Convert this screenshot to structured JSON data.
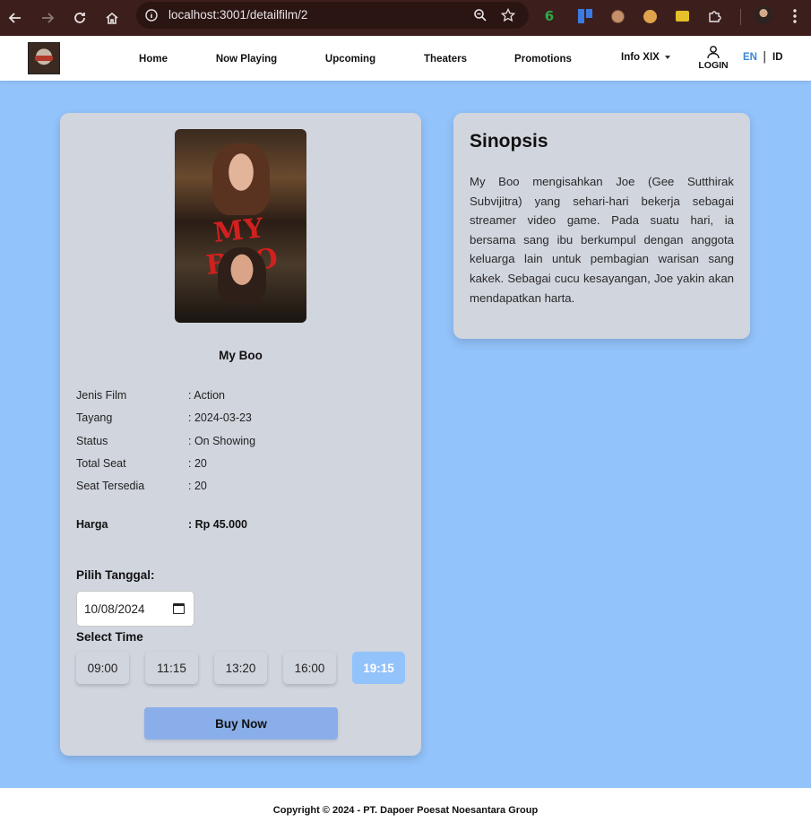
{
  "browser": {
    "url": "localhost:3001/detailfilm/2",
    "extensions": [
      "green-six-icon",
      "blue-bars-icon",
      "cookie-icon",
      "cookie2-icon",
      "tag-icon",
      "puzzle-icon"
    ]
  },
  "header": {
    "nav": [
      "Home",
      "Now Playing",
      "Upcoming",
      "Theaters",
      "Promotions"
    ],
    "info_menu": "Info XIX",
    "login": "LOGIN",
    "lang_en": "EN",
    "lang_sep": "|",
    "lang_id": "ID"
  },
  "film": {
    "title": "My Boo",
    "details": [
      {
        "label": "Jenis Film",
        "value": ": Action"
      },
      {
        "label": "Tayang",
        "value": ": 2024-03-23"
      },
      {
        "label": "Status",
        "value": ": On Showing"
      },
      {
        "label": "Total Seat",
        "value": ": 20"
      },
      {
        "label": "Seat Tersedia",
        "value": ": 20"
      }
    ],
    "price_label": "Harga",
    "price_value": ": Rp 45.000"
  },
  "booking": {
    "date_label": "Pilih Tanggal:",
    "date_value": "10/08/2024",
    "time_label": "Select Time",
    "times": [
      "09:00",
      "11:15",
      "13:20",
      "16:00",
      "19:15"
    ],
    "selected_time": "19:15",
    "buy_label": "Buy Now"
  },
  "synopsis": {
    "title": "Sinopsis",
    "text": "My Boo mengisahkan Joe (Gee Sutthirak Subvijitra) yang sehari-hari bekerja sebagai streamer video game. Pada suatu hari, ia bersama sang ibu berkumpul dengan anggota keluarga lain untuk pembagian warisan sang kakek. Sebagai cucu kesayangan, Joe yakin akan mendapatkan harta."
  },
  "footer": {
    "copyright": "Copyright © 2024 - PT. Dapoer Poesat Noesantara Group"
  },
  "colors": {
    "page_bg": "#93c3fb",
    "card_bg": "#d1d5de",
    "accent_active": "#93c3fb",
    "buy_button": "#8aaee9",
    "lang_active": "#3a86d6"
  }
}
